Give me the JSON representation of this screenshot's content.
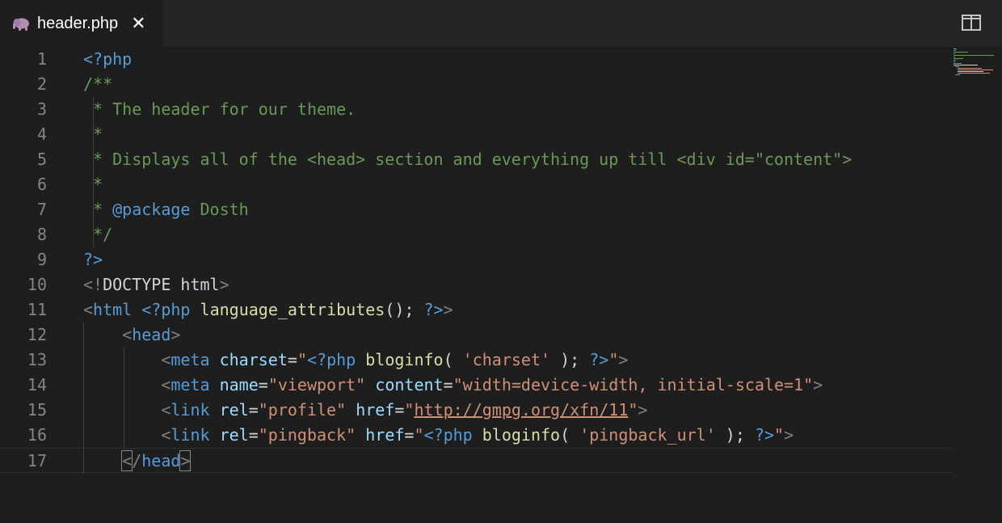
{
  "tab": {
    "title": "header.php",
    "icon": "elephant-icon",
    "icon_color": "#b48ead",
    "close_glyph": "✕"
  },
  "colors": {
    "background": "#1e1e1e",
    "tabbar": "#252526",
    "line_number": "#858585",
    "keyword": "#569cd6",
    "attribute": "#9cdcfe",
    "string": "#ce9178",
    "function": "#dcdcaa",
    "comment": "#6a9955",
    "punctuation": "#808080"
  },
  "editor": {
    "lines": [
      {
        "number": "1",
        "tokens": [
          [
            "php",
            "<?php"
          ]
        ]
      },
      {
        "number": "2",
        "tokens": [
          [
            "com",
            "/**"
          ]
        ]
      },
      {
        "number": "3",
        "tokens": [
          [
            "com",
            " * The header for our theme."
          ]
        ]
      },
      {
        "number": "4",
        "tokens": [
          [
            "com",
            " *"
          ]
        ]
      },
      {
        "number": "5",
        "tokens": [
          [
            "com",
            " * Displays all of the <head> section and everything up till <div id=\"content\">"
          ]
        ]
      },
      {
        "number": "6",
        "tokens": [
          [
            "com",
            " *"
          ]
        ]
      },
      {
        "number": "7",
        "tokens": [
          [
            "com",
            " * "
          ],
          [
            "tag",
            "@package"
          ],
          [
            "com",
            " Dosth"
          ]
        ]
      },
      {
        "number": "8",
        "tokens": [
          [
            "com",
            " */"
          ]
        ]
      },
      {
        "number": "9",
        "tokens": [
          [
            "php",
            "?>"
          ]
        ]
      },
      {
        "number": "10",
        "tokens": [
          [
            "punct",
            "<!"
          ],
          [
            "text",
            "DOCTYPE html"
          ],
          [
            "punct",
            ">"
          ]
        ]
      },
      {
        "number": "11",
        "tokens": [
          [
            "punct",
            "<"
          ],
          [
            "tag",
            "html"
          ],
          [
            "text",
            " "
          ],
          [
            "php",
            "<?php"
          ],
          [
            "text",
            " "
          ],
          [
            "func",
            "language_attributes"
          ],
          [
            "text",
            "(); "
          ],
          [
            "php",
            "?>"
          ],
          [
            "punct",
            ">"
          ]
        ]
      },
      {
        "number": "12",
        "tokens": [
          [
            "text",
            "    "
          ],
          [
            "punct",
            "<"
          ],
          [
            "tag",
            "head"
          ],
          [
            "punct",
            ">"
          ]
        ]
      },
      {
        "number": "13",
        "tokens": [
          [
            "text",
            "        "
          ],
          [
            "punct",
            "<"
          ],
          [
            "tag",
            "meta"
          ],
          [
            "text",
            " "
          ],
          [
            "attr",
            "charset"
          ],
          [
            "text",
            "="
          ],
          [
            "str",
            "\""
          ],
          [
            "php",
            "<?php"
          ],
          [
            "text",
            " "
          ],
          [
            "func",
            "bloginfo"
          ],
          [
            "text",
            "( "
          ],
          [
            "str",
            "'charset'"
          ],
          [
            "text",
            " ); "
          ],
          [
            "php",
            "?>"
          ],
          [
            "str",
            "\""
          ],
          [
            "punct",
            ">"
          ]
        ]
      },
      {
        "number": "14",
        "tokens": [
          [
            "text",
            "        "
          ],
          [
            "punct",
            "<"
          ],
          [
            "tag",
            "meta"
          ],
          [
            "text",
            " "
          ],
          [
            "attr",
            "name"
          ],
          [
            "text",
            "="
          ],
          [
            "str",
            "\"viewport\""
          ],
          [
            "text",
            " "
          ],
          [
            "attr",
            "content"
          ],
          [
            "text",
            "="
          ],
          [
            "str",
            "\"width=device-width, initial-scale=1\""
          ],
          [
            "punct",
            ">"
          ]
        ]
      },
      {
        "number": "15",
        "tokens": [
          [
            "text",
            "        "
          ],
          [
            "punct",
            "<"
          ],
          [
            "tag",
            "link"
          ],
          [
            "text",
            " "
          ],
          [
            "attr",
            "rel"
          ],
          [
            "text",
            "="
          ],
          [
            "str",
            "\"profile\""
          ],
          [
            "text",
            " "
          ],
          [
            "attr",
            "href"
          ],
          [
            "text",
            "="
          ],
          [
            "str",
            "\""
          ],
          [
            "url",
            "http://gmpg.org/xfn/11"
          ],
          [
            "str",
            "\""
          ],
          [
            "punct",
            ">"
          ]
        ]
      },
      {
        "number": "16",
        "tokens": [
          [
            "text",
            "        "
          ],
          [
            "punct",
            "<"
          ],
          [
            "tag",
            "link"
          ],
          [
            "text",
            " "
          ],
          [
            "attr",
            "rel"
          ],
          [
            "text",
            "="
          ],
          [
            "str",
            "\"pingback\""
          ],
          [
            "text",
            " "
          ],
          [
            "attr",
            "href"
          ],
          [
            "text",
            "="
          ],
          [
            "str",
            "\""
          ],
          [
            "php",
            "<?php"
          ],
          [
            "text",
            " "
          ],
          [
            "func",
            "bloginfo"
          ],
          [
            "text",
            "( "
          ],
          [
            "str",
            "'pingback_url'"
          ],
          [
            "text",
            " ); "
          ],
          [
            "php",
            "?>"
          ],
          [
            "str",
            "\""
          ],
          [
            "punct",
            ">"
          ]
        ]
      },
      {
        "number": "17",
        "tokens": [
          [
            "text",
            "    "
          ],
          [
            "bracket",
            "<"
          ],
          [
            "punct",
            "/"
          ],
          [
            "tag",
            "head"
          ],
          [
            "bracket",
            ">"
          ]
        ]
      }
    ]
  }
}
